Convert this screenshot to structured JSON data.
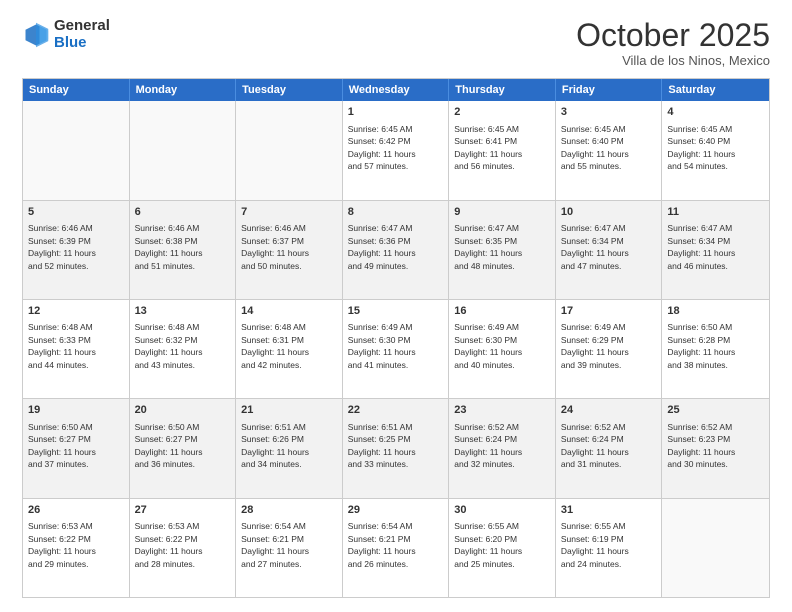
{
  "logo": {
    "general": "General",
    "blue": "Blue"
  },
  "header": {
    "month": "October 2025",
    "location": "Villa de los Ninos, Mexico"
  },
  "days": [
    "Sunday",
    "Monday",
    "Tuesday",
    "Wednesday",
    "Thursday",
    "Friday",
    "Saturday"
  ],
  "rows": [
    [
      {
        "day": "",
        "info": ""
      },
      {
        "day": "",
        "info": ""
      },
      {
        "day": "",
        "info": ""
      },
      {
        "day": "1",
        "info": "Sunrise: 6:45 AM\nSunset: 6:42 PM\nDaylight: 11 hours\nand 57 minutes."
      },
      {
        "day": "2",
        "info": "Sunrise: 6:45 AM\nSunset: 6:41 PM\nDaylight: 11 hours\nand 56 minutes."
      },
      {
        "day": "3",
        "info": "Sunrise: 6:45 AM\nSunset: 6:40 PM\nDaylight: 11 hours\nand 55 minutes."
      },
      {
        "day": "4",
        "info": "Sunrise: 6:45 AM\nSunset: 6:40 PM\nDaylight: 11 hours\nand 54 minutes."
      }
    ],
    [
      {
        "day": "5",
        "info": "Sunrise: 6:46 AM\nSunset: 6:39 PM\nDaylight: 11 hours\nand 52 minutes."
      },
      {
        "day": "6",
        "info": "Sunrise: 6:46 AM\nSunset: 6:38 PM\nDaylight: 11 hours\nand 51 minutes."
      },
      {
        "day": "7",
        "info": "Sunrise: 6:46 AM\nSunset: 6:37 PM\nDaylight: 11 hours\nand 50 minutes."
      },
      {
        "day": "8",
        "info": "Sunrise: 6:47 AM\nSunset: 6:36 PM\nDaylight: 11 hours\nand 49 minutes."
      },
      {
        "day": "9",
        "info": "Sunrise: 6:47 AM\nSunset: 6:35 PM\nDaylight: 11 hours\nand 48 minutes."
      },
      {
        "day": "10",
        "info": "Sunrise: 6:47 AM\nSunset: 6:34 PM\nDaylight: 11 hours\nand 47 minutes."
      },
      {
        "day": "11",
        "info": "Sunrise: 6:47 AM\nSunset: 6:34 PM\nDaylight: 11 hours\nand 46 minutes."
      }
    ],
    [
      {
        "day": "12",
        "info": "Sunrise: 6:48 AM\nSunset: 6:33 PM\nDaylight: 11 hours\nand 44 minutes."
      },
      {
        "day": "13",
        "info": "Sunrise: 6:48 AM\nSunset: 6:32 PM\nDaylight: 11 hours\nand 43 minutes."
      },
      {
        "day": "14",
        "info": "Sunrise: 6:48 AM\nSunset: 6:31 PM\nDaylight: 11 hours\nand 42 minutes."
      },
      {
        "day": "15",
        "info": "Sunrise: 6:49 AM\nSunset: 6:30 PM\nDaylight: 11 hours\nand 41 minutes."
      },
      {
        "day": "16",
        "info": "Sunrise: 6:49 AM\nSunset: 6:30 PM\nDaylight: 11 hours\nand 40 minutes."
      },
      {
        "day": "17",
        "info": "Sunrise: 6:49 AM\nSunset: 6:29 PM\nDaylight: 11 hours\nand 39 minutes."
      },
      {
        "day": "18",
        "info": "Sunrise: 6:50 AM\nSunset: 6:28 PM\nDaylight: 11 hours\nand 38 minutes."
      }
    ],
    [
      {
        "day": "19",
        "info": "Sunrise: 6:50 AM\nSunset: 6:27 PM\nDaylight: 11 hours\nand 37 minutes."
      },
      {
        "day": "20",
        "info": "Sunrise: 6:50 AM\nSunset: 6:27 PM\nDaylight: 11 hours\nand 36 minutes."
      },
      {
        "day": "21",
        "info": "Sunrise: 6:51 AM\nSunset: 6:26 PM\nDaylight: 11 hours\nand 34 minutes."
      },
      {
        "day": "22",
        "info": "Sunrise: 6:51 AM\nSunset: 6:25 PM\nDaylight: 11 hours\nand 33 minutes."
      },
      {
        "day": "23",
        "info": "Sunrise: 6:52 AM\nSunset: 6:24 PM\nDaylight: 11 hours\nand 32 minutes."
      },
      {
        "day": "24",
        "info": "Sunrise: 6:52 AM\nSunset: 6:24 PM\nDaylight: 11 hours\nand 31 minutes."
      },
      {
        "day": "25",
        "info": "Sunrise: 6:52 AM\nSunset: 6:23 PM\nDaylight: 11 hours\nand 30 minutes."
      }
    ],
    [
      {
        "day": "26",
        "info": "Sunrise: 6:53 AM\nSunset: 6:22 PM\nDaylight: 11 hours\nand 29 minutes."
      },
      {
        "day": "27",
        "info": "Sunrise: 6:53 AM\nSunset: 6:22 PM\nDaylight: 11 hours\nand 28 minutes."
      },
      {
        "day": "28",
        "info": "Sunrise: 6:54 AM\nSunset: 6:21 PM\nDaylight: 11 hours\nand 27 minutes."
      },
      {
        "day": "29",
        "info": "Sunrise: 6:54 AM\nSunset: 6:21 PM\nDaylight: 11 hours\nand 26 minutes."
      },
      {
        "day": "30",
        "info": "Sunrise: 6:55 AM\nSunset: 6:20 PM\nDaylight: 11 hours\nand 25 minutes."
      },
      {
        "day": "31",
        "info": "Sunrise: 6:55 AM\nSunset: 6:19 PM\nDaylight: 11 hours\nand 24 minutes."
      },
      {
        "day": "",
        "info": ""
      }
    ]
  ]
}
